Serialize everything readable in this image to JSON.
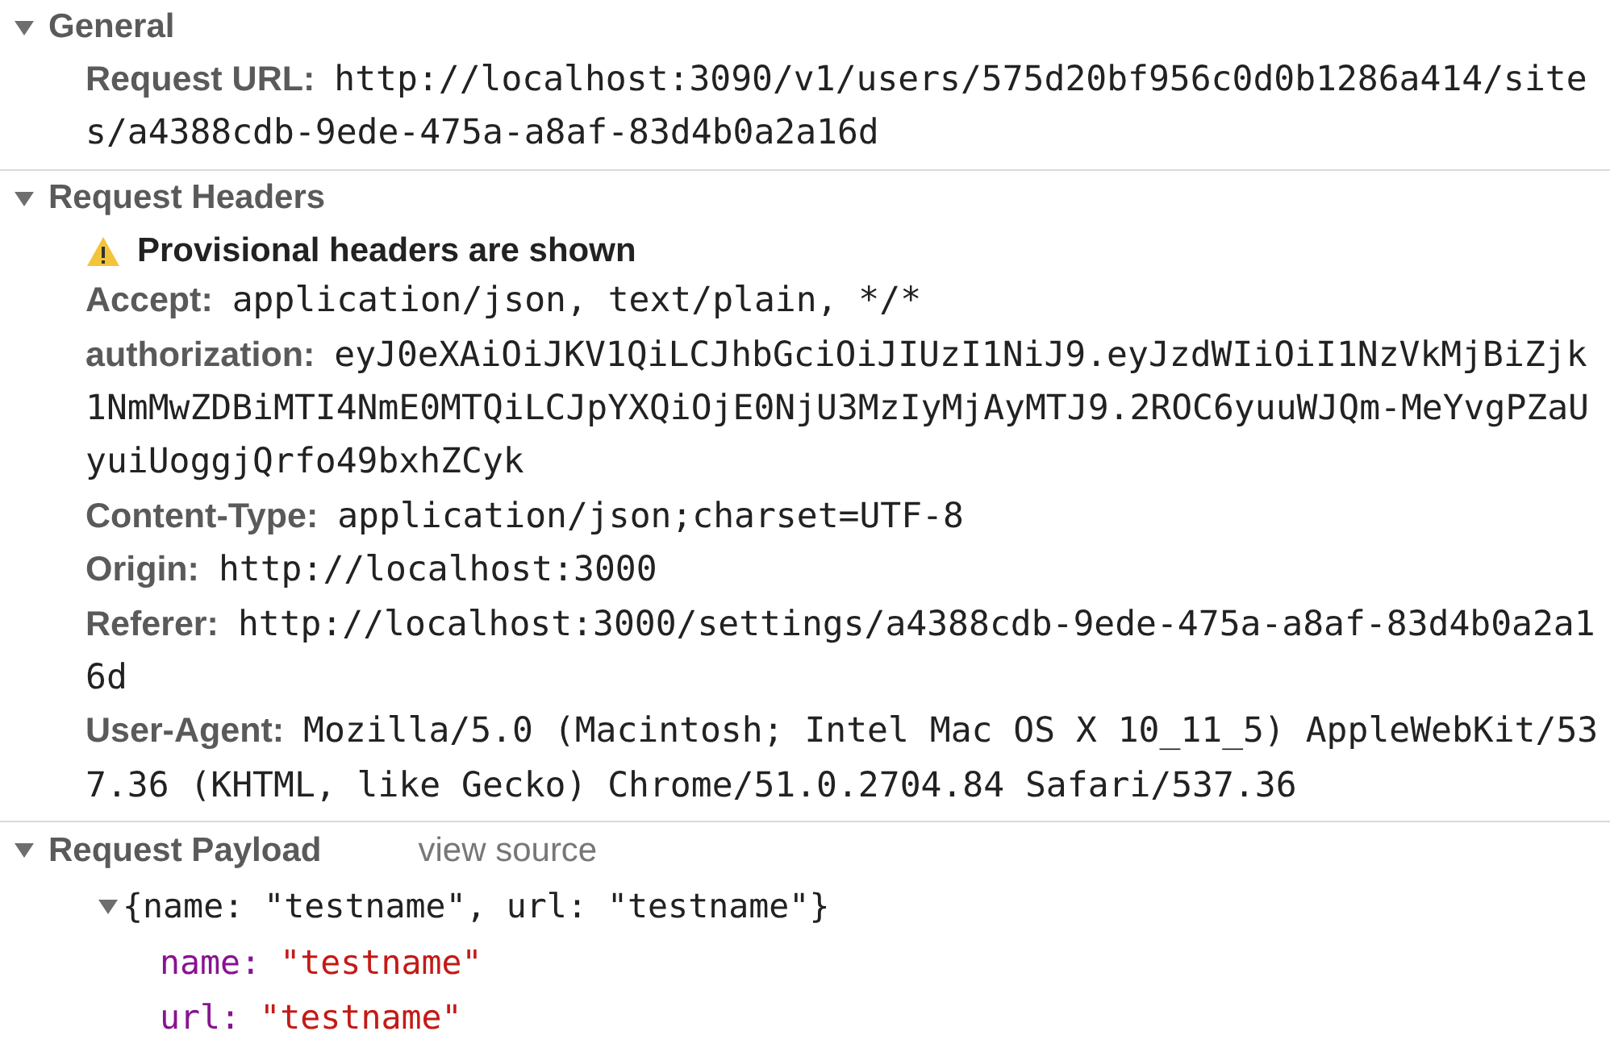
{
  "sections": [
    {
      "kind": "headers",
      "title": "General",
      "expanded": true,
      "rows": [
        {
          "name": "Request URL:",
          "value": "http://localhost:3090/v1/users/575d20bf956c0d0b1286a414/sites/a4388cdb-9ede-475a-a8af-83d4b0a2a16d"
        }
      ]
    },
    {
      "kind": "headers",
      "title": "Request Headers",
      "expanded": true,
      "warning": "Provisional headers are shown",
      "rows": [
        {
          "name": "Accept:",
          "value": "application/json, text/plain, */*"
        },
        {
          "name": "authorization:",
          "value": "eyJ0eXAiOiJKV1QiLCJhbGciOiJIUzI1NiJ9.eyJzdWIiOiI1NzVkMjBiZjk1NmMwZDBiMTI4NmE0MTQiLCJpYXQiOjE0NjU3MzIyMjAyMTJ9.2ROC6yuuWJQm-MeYvgPZaUyuiUoggjQrfo49bxhZCyk"
        },
        {
          "name": "Content-Type:",
          "value": "application/json;charset=UTF-8"
        },
        {
          "name": "Origin:",
          "value": "http://localhost:3000"
        },
        {
          "name": "Referer:",
          "value": "http://localhost:3000/settings/a4388cdb-9ede-475a-a8af-83d4b0a2a16d"
        },
        {
          "name": "User-Agent:",
          "value": "Mozilla/5.0 (Macintosh; Intel Mac OS X 10_11_5) AppleWebKit/537.36 (KHTML, like Gecko) Chrome/51.0.2704.84 Safari/537.36"
        }
      ]
    },
    {
      "kind": "tree",
      "title": "Request Payload",
      "expanded": true,
      "link": "view source",
      "summary": "{name: \"testname\", url: \"testname\"}",
      "summary_expanded": true,
      "props": [
        {
          "key": "name:",
          "value": "\"testname\""
        },
        {
          "key": "url:",
          "value": "\"testname\""
        }
      ]
    }
  ]
}
